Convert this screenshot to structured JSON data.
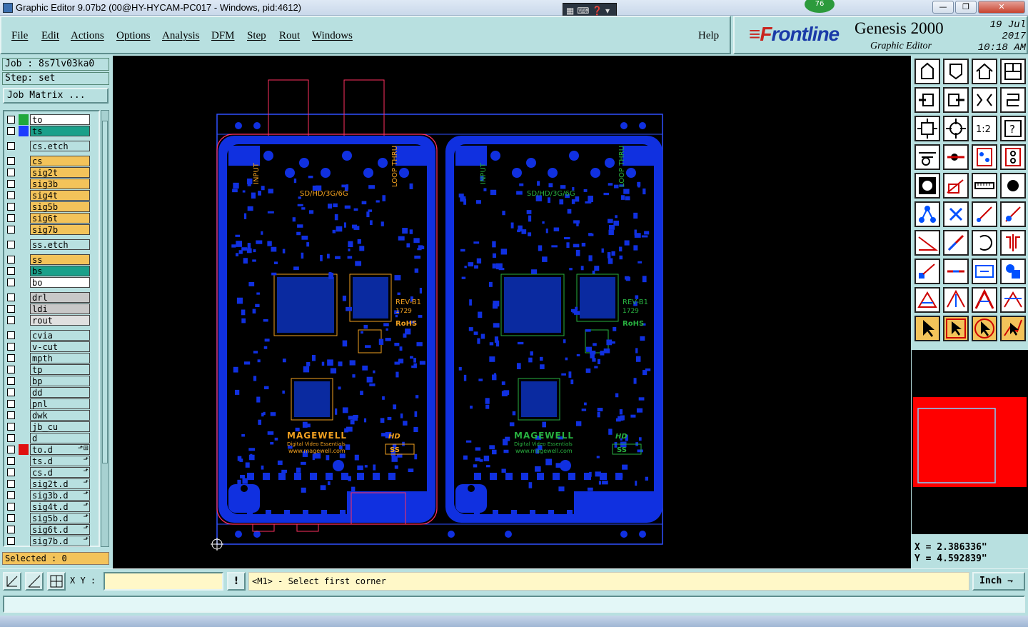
{
  "window": {
    "title": "Graphic Editor 9.07b2 (00@HY-HYCAM-PC017 - Windows, pid:4612)",
    "min": "—",
    "max": "❐",
    "close": "✕",
    "badge": "76"
  },
  "menu": {
    "items": [
      "File",
      "Edit",
      "Actions",
      "Options",
      "Analysis",
      "DFM",
      "Step",
      "Rout",
      "Windows"
    ],
    "help": "Help"
  },
  "brand": {
    "logo_f": "≡F",
    "logo_rest": "rontline",
    "product": "Genesis 2000",
    "subtitle": "Graphic Editor",
    "date": "19 Jul 2017",
    "time": "10:18 AM"
  },
  "job": {
    "job": "Job : 8s7lv03ka0",
    "step": "Step: set",
    "matrix_button": "Job Matrix ..."
  },
  "layers": [
    {
      "name": "to",
      "swatch": "#1fa83c",
      "bg": "#ffffff"
    },
    {
      "name": "ts",
      "swatch": "#1b3cff",
      "bg": "#1aa08a"
    },
    {
      "name": "cs.etch",
      "swatch": "",
      "bg": "#b8e0e0"
    },
    {
      "name": "cs",
      "swatch": "",
      "bg": "#f3c35a"
    },
    {
      "name": "sig2t",
      "swatch": "",
      "bg": "#f3c35a"
    },
    {
      "name": "sig3b",
      "swatch": "",
      "bg": "#f3c35a"
    },
    {
      "name": "sig4t",
      "swatch": "",
      "bg": "#f3c35a"
    },
    {
      "name": "sig5b",
      "swatch": "",
      "bg": "#f3c35a"
    },
    {
      "name": "sig6t",
      "swatch": "",
      "bg": "#f3c35a"
    },
    {
      "name": "sig7b",
      "swatch": "",
      "bg": "#f3c35a"
    },
    {
      "name": "ss.etch",
      "swatch": "",
      "bg": "#b8e0e0"
    },
    {
      "name": "ss",
      "swatch": "",
      "bg": "#f3c35a"
    },
    {
      "name": "bs",
      "swatch": "",
      "bg": "#1aa08a"
    },
    {
      "name": "bo",
      "swatch": "",
      "bg": "#ffffff"
    },
    {
      "name": "drl",
      "swatch": "",
      "bg": "#c8c8c8"
    },
    {
      "name": "ldi",
      "swatch": "",
      "bg": "#c8c8c8"
    },
    {
      "name": "rout",
      "swatch": "",
      "bg": "#e0e0e0"
    },
    {
      "name": "cvia",
      "swatch": "",
      "bg": "#b8e0e0"
    },
    {
      "name": "v-cut",
      "swatch": "",
      "bg": "#b8e0e0"
    },
    {
      "name": "mpth",
      "swatch": "",
      "bg": "#b8e0e0"
    },
    {
      "name": "tp",
      "swatch": "",
      "bg": "#b8e0e0"
    },
    {
      "name": "bp",
      "swatch": "",
      "bg": "#b8e0e0"
    },
    {
      "name": "dd",
      "swatch": "",
      "bg": "#b8e0e0"
    },
    {
      "name": "pnl",
      "swatch": "",
      "bg": "#b8e0e0"
    },
    {
      "name": "dwk",
      "swatch": "",
      "bg": "#b8e0e0"
    },
    {
      "name": "jb_cu",
      "swatch": "",
      "bg": "#b8e0e0"
    },
    {
      "name": "d",
      "swatch": "",
      "bg": "#b8e0e0"
    },
    {
      "name": "to.d",
      "swatch": "#e01010",
      "bg": "#b8e0e0",
      "tool": "⬏⊞"
    },
    {
      "name": "ts.d",
      "swatch": "",
      "bg": "#b8e0e0",
      "tool": "⬏"
    },
    {
      "name": "cs.d",
      "swatch": "",
      "bg": "#b8e0e0",
      "tool": "⬏"
    },
    {
      "name": "sig2t.d",
      "swatch": "",
      "bg": "#b8e0e0",
      "tool": "⬏"
    },
    {
      "name": "sig3b.d",
      "swatch": "",
      "bg": "#b8e0e0",
      "tool": "⬏"
    },
    {
      "name": "sig4t.d",
      "swatch": "",
      "bg": "#b8e0e0",
      "tool": "⬏"
    },
    {
      "name": "sig5b.d",
      "swatch": "",
      "bg": "#b8e0e0",
      "tool": "⬏"
    },
    {
      "name": "sig6t.d",
      "swatch": "",
      "bg": "#b8e0e0",
      "tool": "⬏"
    },
    {
      "name": "sig7b.d",
      "swatch": "",
      "bg": "#b8e0e0",
      "tool": "⬏"
    }
  ],
  "selected": "Selected : 0",
  "board": {
    "left": {
      "input": "INPUT",
      "loop": "LOOP THRU",
      "format": "SD/HD/3G/6G",
      "rev": "REV-B1",
      "code": "1729",
      "rohs": "RoHS",
      "brand": "MAGEWELL",
      "tagline": "Digital Video Essentials",
      "url": "www.magewell.com",
      "hd": "HD",
      "ss": "SS"
    },
    "right": {
      "input": "INPUT",
      "loop": "LOOP THRU",
      "format": "SD/HD/3G/6G",
      "rev": "REV-B1",
      "code": "1729",
      "rohs": "RoHS",
      "brand": "MAGEWELL",
      "tagline": "Digital Video Essentials",
      "url": "www.magewell.com",
      "hd": "HD",
      "ss": "SS"
    }
  },
  "tools": [
    "open-step-icon",
    "save-icon",
    "home-icon",
    "window-icon",
    "zoom-left-icon",
    "zoom-right-icon",
    "zoom-fit-icon",
    "redraw-icon",
    "fit-icon",
    "center-icon",
    "ratio-icon",
    "help-icon",
    "ruler-icon",
    "measure-icon",
    "layers-red-icon",
    "layers-red2-icon",
    "pad-icon",
    "edit-shape-icon",
    "ruler-scale-icon",
    "dot-icon",
    "snap-icon",
    "cross-icon",
    "line-icon",
    "line2-icon",
    "angle-icon",
    "diag-icon",
    "rotate-icon",
    "mirror-icon",
    "pad-move-icon",
    "line-h-icon",
    "resize-icon",
    "layers-icon",
    "triangle-icon",
    "triangle2-icon",
    "triangle3-icon",
    "triangle4-icon",
    "select-icon",
    "select-box-icon",
    "select-circle-icon",
    "select-path-icon"
  ],
  "tool_labels": {
    "ratio": "1:2",
    "help": "?"
  },
  "coords": {
    "x": "X = 2.386336\"",
    "y": "Y = 4.592839\""
  },
  "bottom": {
    "xy_label": "X Y :",
    "xy_value": "",
    "prompt": "<M1> - Select first corner",
    "unit": "Inch",
    "warn": "!"
  },
  "colors": {
    "panel": "#b8e0e0",
    "copper": "#1030e0",
    "silk_orange": "#f0a020",
    "silk_green": "#28b040",
    "outline": "#ff3060",
    "rout": "#3050ff"
  }
}
